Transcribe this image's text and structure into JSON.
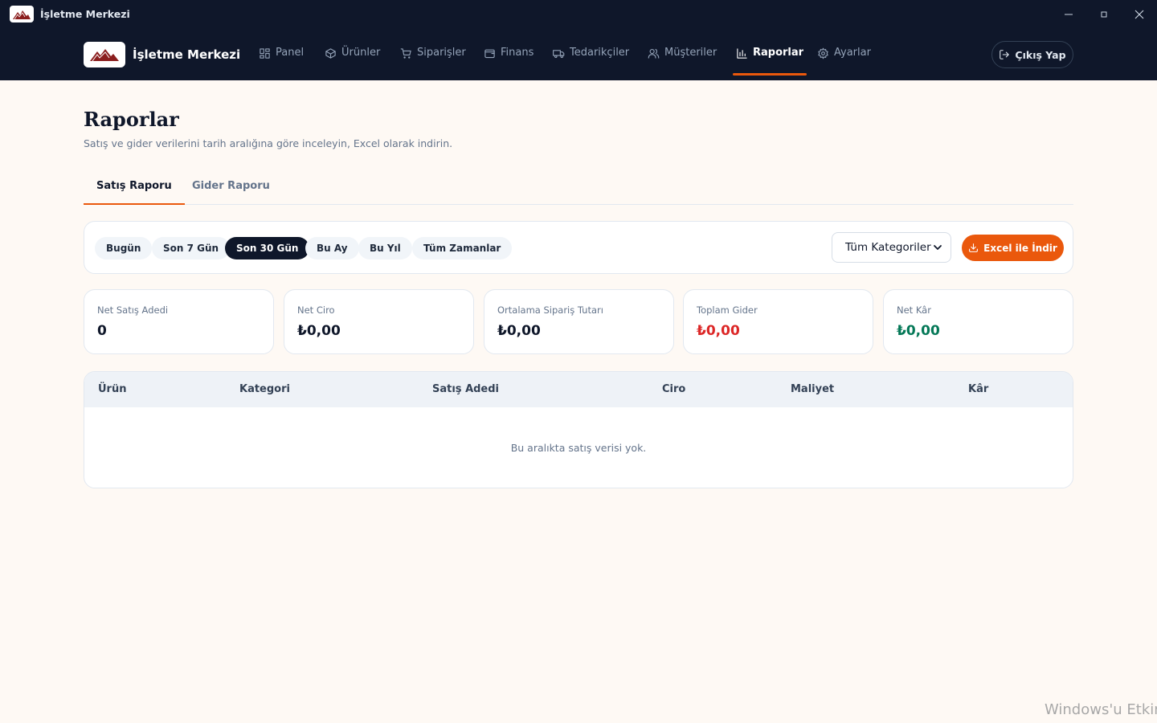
{
  "window": {
    "title": "İşletme Merkezi",
    "controls": [
      "minimize",
      "maximize",
      "close"
    ]
  },
  "brand": {
    "name": "İşletme Merkezi"
  },
  "nav": {
    "items": [
      {
        "label": "Panel",
        "icon": "grid-icon"
      },
      {
        "label": "Ürünler",
        "icon": "box-icon"
      },
      {
        "label": "Siparişler",
        "icon": "cart-icon"
      },
      {
        "label": "Finans",
        "icon": "wallet-icon"
      },
      {
        "label": "Tedarikçiler",
        "icon": "truck-icon"
      },
      {
        "label": "Müşteriler",
        "icon": "users-icon"
      },
      {
        "label": "Raporlar",
        "icon": "bar-chart-icon",
        "active": true
      },
      {
        "label": "Ayarlar",
        "icon": "gear-icon"
      }
    ],
    "logout_label": "Çıkış Yap"
  },
  "page": {
    "title": "Raporlar",
    "subtitle": "Satış ve gider verilerini tarih aralığına göre inceleyin, Excel olarak indirin."
  },
  "tabs": [
    {
      "label": "Satış Raporu",
      "active": true
    },
    {
      "label": "Gider Raporu",
      "active": false
    }
  ],
  "filters": {
    "ranges": [
      {
        "label": "Bugün",
        "active": false
      },
      {
        "label": "Son 7 Gün",
        "active": false
      },
      {
        "label": "Son 30 Gün",
        "active": true
      },
      {
        "label": "Bu Ay",
        "active": false
      },
      {
        "label": "Bu Yıl",
        "active": false
      },
      {
        "label": "Tüm Zamanlar",
        "active": false
      }
    ],
    "category_selected": "Tüm Kategoriler",
    "excel_label": "Excel ile İndir"
  },
  "stats": [
    {
      "label": "Net Satış Adedi",
      "value": "0"
    },
    {
      "label": "Net Ciro",
      "value": "₺0,00"
    },
    {
      "label": "Ortalama Sipariş Tutarı",
      "value": "₺0,00"
    },
    {
      "label": "Toplam Gider",
      "value": "₺0,00"
    },
    {
      "label": "Net Kâr",
      "value": "₺0,00"
    }
  ],
  "table": {
    "columns": [
      "Ürün",
      "Kategori",
      "Satış Adedi",
      "Ciro",
      "Maliyet",
      "Kâr"
    ],
    "rows": [],
    "empty_text": "Bu aralıkta satış verisi yok."
  },
  "watermark": "Windows'u Etkin",
  "colors": {
    "accent": "#ea580c",
    "nav_bg": "#0f172a",
    "page_bg": "#fef9f4",
    "negative": "#dc2626",
    "positive": "#047857"
  }
}
